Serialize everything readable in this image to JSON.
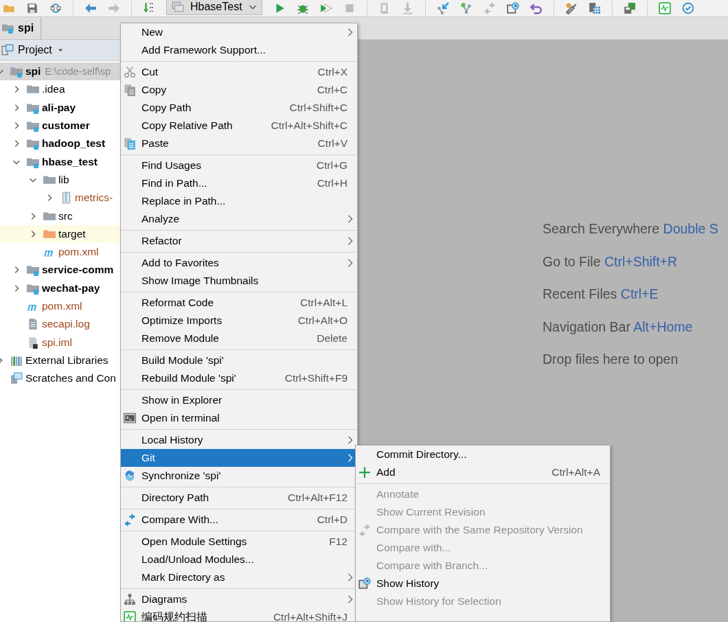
{
  "toolbar": [
    {
      "kind": "folder",
      "disabled": false
    },
    {
      "kind": "save",
      "disabled": false
    },
    {
      "kind": "sync",
      "disabled": false
    },
    {
      "kind": "separator"
    },
    {
      "kind": "back",
      "disabled": false
    },
    {
      "kind": "forward",
      "disabled": true
    },
    {
      "kind": "separator"
    },
    {
      "kind": "build",
      "disabled": false
    },
    {
      "kind": "config",
      "label": "HbaseTest"
    },
    {
      "kind": "run",
      "disabled": false
    },
    {
      "kind": "debug",
      "disabled": false
    },
    {
      "kind": "coverage",
      "disabled": false
    },
    {
      "kind": "stop",
      "disabled": true
    },
    {
      "kind": "separator"
    },
    {
      "kind": "device",
      "disabled": true
    },
    {
      "kind": "download",
      "disabled": true
    },
    {
      "kind": "separator"
    },
    {
      "kind": "update",
      "disabled": false
    },
    {
      "kind": "commit",
      "disabled": false
    },
    {
      "kind": "compare",
      "disabled": true
    },
    {
      "kind": "history",
      "disabled": false
    },
    {
      "kind": "revert",
      "disabled": false
    },
    {
      "kind": "separator"
    },
    {
      "kind": "wrench",
      "disabled": false
    },
    {
      "kind": "structure",
      "disabled": false
    },
    {
      "kind": "separator"
    },
    {
      "kind": "sdk",
      "disabled": false
    },
    {
      "kind": "separator"
    },
    {
      "kind": "monitor",
      "disabled": false
    },
    {
      "kind": "check",
      "disabled": false
    }
  ],
  "breadcrumb": {
    "label": "spi"
  },
  "project_panel": {
    "title": "Project",
    "tree": [
      {
        "label": "spi",
        "path": "E:\\code-self\\sp",
        "kind": "module",
        "expanded": true,
        "selected": true,
        "highlighted": false,
        "color": "#000000",
        "children": [
          {
            "label": ".idea",
            "kind": "folder",
            "expanded": false,
            "selected": false,
            "highlighted": false,
            "color": "#000000"
          },
          {
            "label": "ali-pay",
            "kind": "module",
            "expanded": false,
            "selected": false,
            "highlighted": false,
            "color": "#000000"
          },
          {
            "label": "customer",
            "kind": "module",
            "expanded": false,
            "selected": false,
            "highlighted": false,
            "color": "#000000"
          },
          {
            "label": "hadoop_test",
            "kind": "module",
            "expanded": false,
            "selected": false,
            "highlighted": false,
            "color": "#000000"
          },
          {
            "label": "hbase_test",
            "kind": "module",
            "expanded": true,
            "selected": false,
            "highlighted": false,
            "color": "#000000",
            "children": [
              {
                "label": "lib",
                "kind": "folder",
                "expanded": true,
                "selected": false,
                "highlighted": false,
                "color": "#000000",
                "children": [
                  {
                    "label": "metrics-",
                    "kind": "jar",
                    "expanded": false,
                    "selected": false,
                    "highlighted": false,
                    "color": "#a0451c"
                  }
                ]
              },
              {
                "label": "src",
                "kind": "folder",
                "expanded": false,
                "selected": false,
                "highlighted": false,
                "color": "#000000"
              },
              {
                "label": "target",
                "kind": "excluded",
                "expanded": false,
                "selected": false,
                "highlighted": true,
                "color": "#000000"
              },
              {
                "label": "pom.xml",
                "kind": "maven",
                "selected": false,
                "highlighted": false,
                "color": "#a0451c"
              }
            ]
          },
          {
            "label": "service-comm",
            "kind": "module",
            "expanded": false,
            "selected": false,
            "highlighted": false,
            "color": "#000000"
          },
          {
            "label": "wechat-pay",
            "kind": "module",
            "expanded": false,
            "selected": false,
            "highlighted": false,
            "color": "#000000"
          },
          {
            "label": "pom.xml",
            "kind": "maven",
            "selected": false,
            "highlighted": false,
            "color": "#a0451c"
          },
          {
            "label": "secapi.log",
            "kind": "log",
            "selected": false,
            "highlighted": false,
            "color": "#a0451c"
          },
          {
            "label": "spi.iml",
            "kind": "iml",
            "selected": false,
            "highlighted": false,
            "color": "#a0451c"
          }
        ]
      },
      {
        "label": "External Libraries",
        "kind": "libraries",
        "expanded": false,
        "selected": false,
        "highlighted": false,
        "color": "#000000"
      },
      {
        "label": "Scratches and Con",
        "kind": "scratches",
        "selected": false,
        "highlighted": false,
        "color": "#000000"
      }
    ]
  },
  "editor_tips": [
    {
      "label": "Search Everywhere",
      "shortcut": "Double S"
    },
    {
      "label": "Go to File",
      "shortcut": "Ctrl+Shift+R"
    },
    {
      "label": "Recent Files",
      "shortcut": "Ctrl+E"
    },
    {
      "label": "Navigation Bar",
      "shortcut": "Alt+Home"
    },
    {
      "label": "Drop files here to open"
    }
  ],
  "context_menu": {
    "groups": [
      {
        "items": [
          {
            "label": "New",
            "kind": "plain",
            "submenu": true,
            "selected": false
          },
          {
            "label": "Add Framework Support...",
            "kind": "plain",
            "submenu": false,
            "selected": false
          }
        ]
      },
      {
        "items": [
          {
            "label": "Cut",
            "shortcut": "Ctrl+X",
            "kind": "cut",
            "submenu": false,
            "selected": false
          },
          {
            "label": "Copy",
            "shortcut": "Ctrl+C",
            "kind": "copy",
            "submenu": false,
            "selected": false
          },
          {
            "label": "Copy Path",
            "shortcut": "Ctrl+Shift+C",
            "kind": "plain",
            "submenu": false,
            "selected": false
          },
          {
            "label": "Copy Relative Path",
            "shortcut": "Ctrl+Alt+Shift+C",
            "kind": "plain",
            "submenu": false,
            "selected": false
          },
          {
            "label": "Paste",
            "shortcut": "Ctrl+V",
            "kind": "paste",
            "submenu": false,
            "selected": false
          }
        ]
      },
      {
        "items": [
          {
            "label": "Find Usages",
            "shortcut": "Ctrl+G",
            "kind": "plain",
            "submenu": false,
            "selected": false
          },
          {
            "label": "Find in Path...",
            "shortcut": "Ctrl+H",
            "kind": "plain",
            "submenu": false,
            "selected": false
          },
          {
            "label": "Replace in Path...",
            "kind": "plain",
            "submenu": false,
            "selected": false
          },
          {
            "label": "Analyze",
            "kind": "plain",
            "submenu": true,
            "selected": false
          }
        ]
      },
      {
        "items": [
          {
            "label": "Refactor",
            "kind": "plain",
            "submenu": true,
            "selected": false
          }
        ]
      },
      {
        "items": [
          {
            "label": "Add to Favorites",
            "kind": "plain",
            "submenu": true,
            "selected": false
          },
          {
            "label": "Show Image Thumbnails",
            "kind": "plain",
            "submenu": false,
            "selected": false
          }
        ]
      },
      {
        "items": [
          {
            "label": "Reformat Code",
            "shortcut": "Ctrl+Alt+L",
            "kind": "plain",
            "submenu": false,
            "selected": false
          },
          {
            "label": "Optimize Imports",
            "shortcut": "Ctrl+Alt+O",
            "kind": "plain",
            "submenu": false,
            "selected": false
          },
          {
            "label": "Remove Module",
            "shortcut": "Delete",
            "kind": "plain",
            "submenu": false,
            "selected": false
          }
        ]
      },
      {
        "items": [
          {
            "label": "Build Module 'spi'",
            "kind": "plain",
            "submenu": false,
            "selected": false
          },
          {
            "label": "Rebuild Module 'spi'",
            "shortcut": "Ctrl+Shift+F9",
            "kind": "plain",
            "submenu": false,
            "selected": false
          }
        ]
      },
      {
        "items": [
          {
            "label": "Show in Explorer",
            "kind": "plain",
            "submenu": false,
            "selected": false
          },
          {
            "label": "Open in terminal",
            "kind": "terminal",
            "submenu": false,
            "selected": false
          }
        ]
      },
      {
        "items": [
          {
            "label": "Local History",
            "kind": "plain",
            "submenu": true,
            "selected": false
          },
          {
            "label": "Git",
            "kind": "plain",
            "submenu": true,
            "selected": true
          },
          {
            "label": "Synchronize 'spi'",
            "kind": "sync",
            "submenu": false,
            "selected": false
          }
        ]
      },
      {
        "items": [
          {
            "label": "Directory Path",
            "shortcut": "Ctrl+Alt+F12",
            "kind": "plain",
            "submenu": false,
            "selected": false
          }
        ]
      },
      {
        "items": [
          {
            "label": "Compare With...",
            "shortcut": "Ctrl+D",
            "kind": "compare",
            "submenu": false,
            "selected": false
          }
        ]
      },
      {
        "items": [
          {
            "label": "Open Module Settings",
            "shortcut": "F12",
            "kind": "plain",
            "submenu": false,
            "selected": false
          },
          {
            "label": "Load/Unload Modules...",
            "kind": "plain",
            "submenu": false,
            "selected": false
          },
          {
            "label": "Mark Directory as",
            "kind": "plain",
            "submenu": true,
            "selected": false
          }
        ]
      },
      {
        "items": [
          {
            "label": "Diagrams",
            "kind": "diagram",
            "submenu": true,
            "selected": false
          },
          {
            "label": "编码规约扫描",
            "shortcut": "Ctrl+Alt+Shift+J",
            "kind": "monitor",
            "submenu": false,
            "selected": false
          }
        ]
      }
    ]
  },
  "git_submenu": {
    "groups": [
      {
        "items": [
          {
            "label": "Commit Directory...",
            "kind": "plain",
            "disabled": false
          },
          {
            "label": "Add",
            "shortcut": "Ctrl+Alt+A",
            "kind": "plus",
            "disabled": false
          }
        ]
      },
      {
        "items": [
          {
            "label": "Annotate",
            "kind": "plain",
            "disabled": true
          },
          {
            "label": "Show Current Revision",
            "kind": "plain",
            "disabled": true
          },
          {
            "label": "Compare with the Same Repository Version",
            "kind": "compare",
            "disabled": true
          },
          {
            "label": "Compare with...",
            "kind": "plain",
            "disabled": true
          },
          {
            "label": "Compare with Branch...",
            "kind": "plain",
            "disabled": true
          },
          {
            "label": "Show History",
            "kind": "history",
            "disabled": false
          },
          {
            "label": "Show History for Selection",
            "kind": "plain",
            "disabled": true
          }
        ]
      }
    ]
  }
}
